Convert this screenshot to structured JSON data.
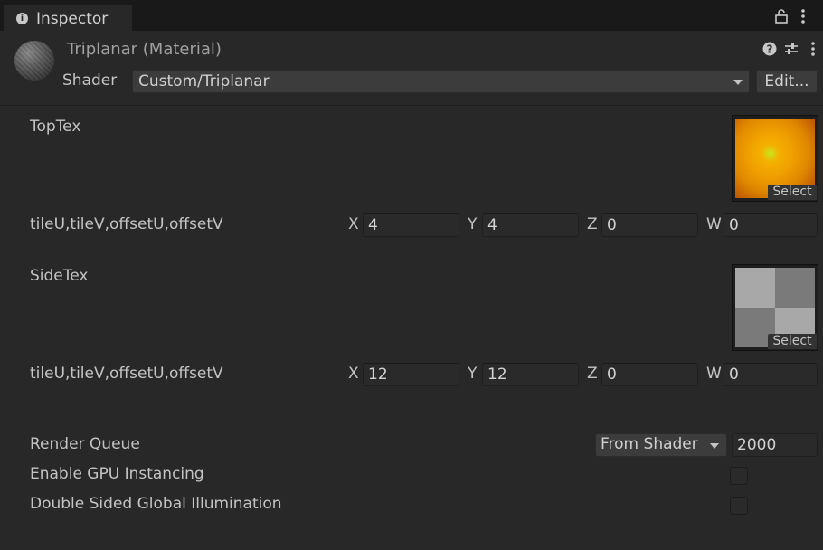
{
  "tab": {
    "label": "Inspector",
    "icon": "info-icon"
  },
  "toolbar": {
    "icons": [
      "lock-icon",
      "more-vert-icon"
    ]
  },
  "material": {
    "title": "Triplanar (Material)",
    "shader_label": "Shader",
    "shader_value": "Custom/Triplanar",
    "edit_label": "Edit...",
    "header_icons": [
      "help-icon",
      "preset-icon",
      "more-vert-icon"
    ]
  },
  "properties": [
    {
      "name": "TopTex",
      "select_label": "Select",
      "vector_label": "tileU,tileV,offsetU,offsetV",
      "vector": {
        "x_label": "X",
        "x": "4",
        "y_label": "Y",
        "y": "4",
        "z_label": "Z",
        "z": "0",
        "w_label": "W",
        "w": "0"
      },
      "texture_colors": [
        "#f5a400",
        "#d46a00",
        "#b8e020"
      ]
    },
    {
      "name": "SideTex",
      "select_label": "Select",
      "vector_label": "tileU,tileV,offsetU,offsetV",
      "vector": {
        "x_label": "X",
        "x": "12",
        "y_label": "Y",
        "y": "12",
        "z_label": "Z",
        "z": "0",
        "w_label": "W",
        "w": "0"
      },
      "texture_colors": [
        "#a8a8a8",
        "#7a7a7a"
      ]
    }
  ],
  "render_queue": {
    "label": "Render Queue",
    "mode": "From Shader",
    "value": "2000"
  },
  "gpu_instancing": {
    "label": "Enable GPU Instancing",
    "checked": false
  },
  "double_sided_gi": {
    "label": "Double Sided Global Illumination",
    "checked": false
  }
}
